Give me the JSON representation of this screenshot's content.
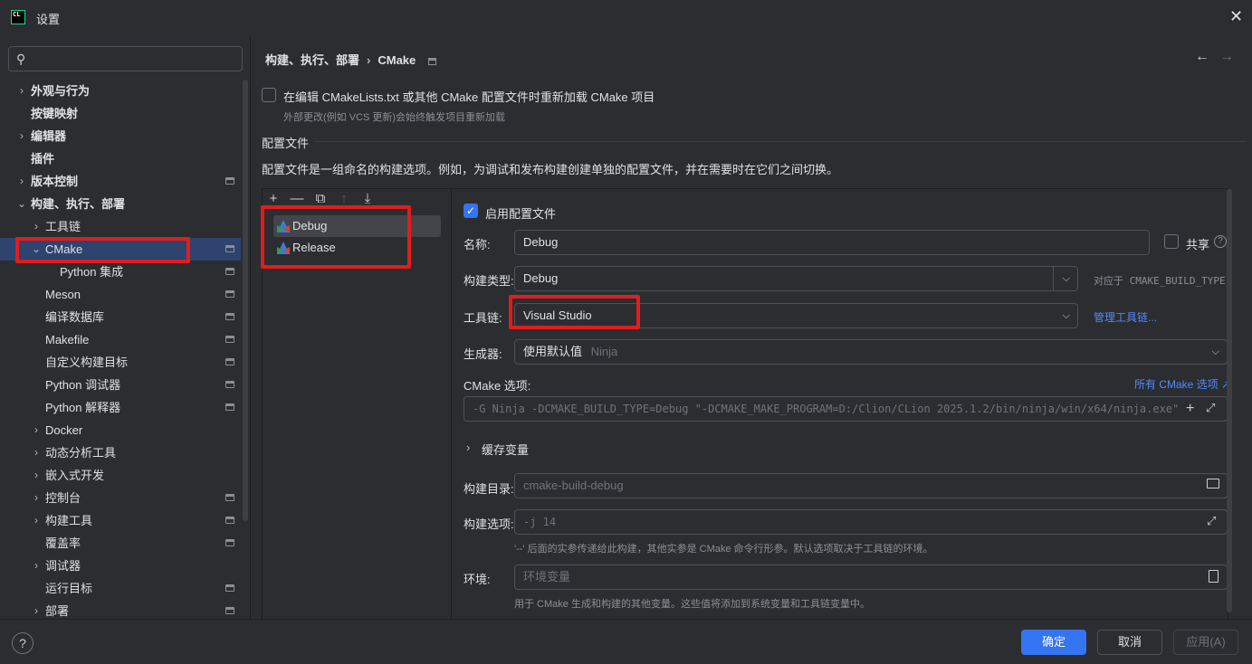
{
  "window": {
    "logo_text": "CL",
    "title": "设置",
    "close": "✕"
  },
  "sidebar": {
    "search_placeholder": "",
    "items": [
      {
        "label": "外观与行为",
        "chevron": "›",
        "bold": true
      },
      {
        "label": "按键映射",
        "bold": true
      },
      {
        "label": "编辑器",
        "chevron": "›",
        "bold": true
      },
      {
        "label": "插件",
        "bold": true
      },
      {
        "label": "版本控制",
        "chevron": "›",
        "bold": true,
        "pin": true
      },
      {
        "label": "构建、执行、部署",
        "chevron": "⌄",
        "bold": true
      },
      {
        "label": "工具链",
        "chevron": "›"
      },
      {
        "label": "CMake",
        "chevron": "⌄",
        "pin": true,
        "selected": true
      },
      {
        "label": "Python 集成",
        "pin": true
      },
      {
        "label": "Meson",
        "pin": true
      },
      {
        "label": "编译数据库",
        "pin": true
      },
      {
        "label": "Makefile",
        "pin": true
      },
      {
        "label": "自定义构建目标",
        "pin": true
      },
      {
        "label": "Python 调试器",
        "pin": true
      },
      {
        "label": "Python 解释器",
        "pin": true
      },
      {
        "label": "Docker",
        "chevron": "›"
      },
      {
        "label": "动态分析工具",
        "chevron": "›"
      },
      {
        "label": "嵌入式开发",
        "chevron": "›"
      },
      {
        "label": "控制台",
        "chevron": "›",
        "pin": true
      },
      {
        "label": "构建工具",
        "chevron": "›",
        "pin": true
      },
      {
        "label": "覆盖率",
        "pin": true
      },
      {
        "label": "调试器",
        "chevron": "›"
      },
      {
        "label": "运行目标",
        "pin": true
      },
      {
        "label": "部署",
        "chevron": "›",
        "pin": true
      }
    ]
  },
  "breadcrumb": {
    "parent": "构建、执行、部署",
    "separator": "›",
    "current": "CMake"
  },
  "nav": {
    "back": "←",
    "forward": "→"
  },
  "reload": {
    "label": "在编辑 CMakeLists.txt 或其他 CMake 配置文件时重新加载 CMake 项目",
    "hint": "外部更改(例如 VCS 更新)会始终触发项目重新加载",
    "checked": false
  },
  "profiles": {
    "title": "配置文件",
    "description": "配置文件是一组命名的构建选项。例如，为调试和发布构建创建单独的配置文件，并在需要时在它们之间切换。",
    "toolbar": [
      "+",
      "—",
      "⧉",
      "↑",
      "⤓"
    ],
    "list": [
      "Debug",
      "Release"
    ],
    "selected": "Debug"
  },
  "form": {
    "enable_label": "启用配置文件",
    "enable_checked": "✓",
    "name_label": "名称:",
    "name_value": "Debug",
    "share_label": "共享",
    "help_icon": "?",
    "build_type_label": "构建类型:",
    "build_type_value": "Debug",
    "build_type_hint": "对应于 CMAKE_BUILD_TYPE",
    "toolchain_label": "工具链:",
    "toolchain_value": "Visual Studio",
    "toolchain_link": "管理工具链...",
    "generator_label": "生成器:",
    "generator_value": "使用默认值",
    "generator_default": "Ninja",
    "cmake_options_label": "CMake 选项:",
    "all_cmake_options_link": "所有 CMake 选项 ↗",
    "cmake_options_value": "-G Ninja -DCMAKE_BUILD_TYPE=Debug \"-DCMAKE_MAKE_PROGRAM=D:/Clion/CLion 2025.1.2/bin/ninja/win/x64/ninja.exe\"",
    "cache_label": "缓存变量",
    "build_dir_label": "构建目录:",
    "build_dir_value": "cmake-build-debug",
    "build_options_label": "构建选项:",
    "build_options_value": "-j 14",
    "build_options_hint": "'--' 后面的实参传递给此构建，其他实参是 CMake 命令行形参。默认选项取决于工具链的环境。",
    "env_label": "环境:",
    "env_placeholder": "环境变量",
    "env_hint": "用于 CMake 生成和构建的其他变量。这些值将添加到系统变量和工具链变量中。"
  },
  "footer": {
    "help": "?",
    "ok": "确定",
    "cancel": "取消",
    "apply": "应用(A)"
  },
  "colors": {
    "accent": "#3574f0",
    "annotation": "#e11d1d",
    "link": "#548af7"
  }
}
